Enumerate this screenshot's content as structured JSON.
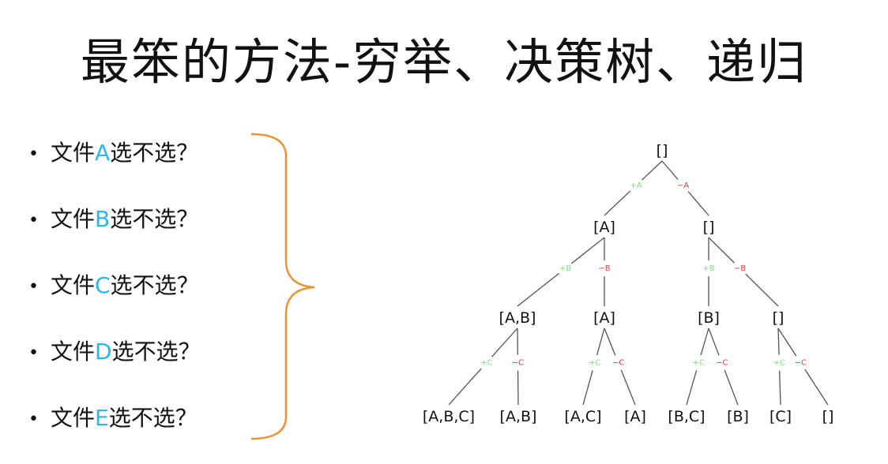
{
  "title": "最笨的方法-穷举、决策树、递归",
  "list": {
    "bullet": "•",
    "items": [
      {
        "prefix": "文件",
        "letter": "A",
        "suffix": "选不选？"
      },
      {
        "prefix": "文件",
        "letter": "B",
        "suffix": "选不选？"
      },
      {
        "prefix": "文件",
        "letter": "C",
        "suffix": "选不选？"
      },
      {
        "prefix": "文件",
        "letter": "D",
        "suffix": "选不选？"
      },
      {
        "prefix": "文件",
        "letter": "E",
        "suffix": "选不选？"
      }
    ]
  },
  "colors": {
    "accent": "#2db6ea",
    "brace": "#e8953a",
    "include_edge": "#7ee07a",
    "exclude_edge": "#e03c3c",
    "line": "#555555"
  },
  "tree": {
    "nodes": [
      {
        "id": "n0",
        "label": "[]"
      },
      {
        "id": "n1",
        "label": "[A]"
      },
      {
        "id": "n2",
        "label": "[]"
      },
      {
        "id": "n3",
        "label": "[A,B]"
      },
      {
        "id": "n4",
        "label": "[A]"
      },
      {
        "id": "n5",
        "label": "[B]"
      },
      {
        "id": "n6",
        "label": "[]"
      },
      {
        "id": "n7",
        "label": "[A,B,C]"
      },
      {
        "id": "n8",
        "label": "[A,B]"
      },
      {
        "id": "n9",
        "label": "[A,C]"
      },
      {
        "id": "n10",
        "label": "[A]"
      },
      {
        "id": "n11",
        "label": "[B,C]"
      },
      {
        "id": "n12",
        "label": "[B]"
      },
      {
        "id": "n13",
        "label": "[C]"
      },
      {
        "id": "n14",
        "label": "[]"
      }
    ],
    "edges": [
      {
        "from": "n0",
        "to": "n1",
        "label": "+A",
        "kind": "include"
      },
      {
        "from": "n0",
        "to": "n2",
        "label": "−A",
        "kind": "exclude"
      },
      {
        "from": "n1",
        "to": "n3",
        "label": "+B",
        "kind": "include"
      },
      {
        "from": "n1",
        "to": "n4",
        "label": "−B",
        "kind": "exclude"
      },
      {
        "from": "n2",
        "to": "n5",
        "label": "+B",
        "kind": "include"
      },
      {
        "from": "n2",
        "to": "n6",
        "label": "−B",
        "kind": "exclude"
      },
      {
        "from": "n3",
        "to": "n7",
        "label": "+C",
        "kind": "include"
      },
      {
        "from": "n3",
        "to": "n8",
        "label": "−C",
        "kind": "exclude"
      },
      {
        "from": "n4",
        "to": "n9",
        "label": "+C",
        "kind": "include"
      },
      {
        "from": "n4",
        "to": "n10",
        "label": "−C",
        "kind": "exclude"
      },
      {
        "from": "n5",
        "to": "n11",
        "label": "+C",
        "kind": "include"
      },
      {
        "from": "n5",
        "to": "n12",
        "label": "−C",
        "kind": "exclude"
      },
      {
        "from": "n6",
        "to": "n13",
        "label": "+C",
        "kind": "include"
      },
      {
        "from": "n6",
        "to": "n14",
        "label": "−C",
        "kind": "exclude"
      }
    ]
  }
}
